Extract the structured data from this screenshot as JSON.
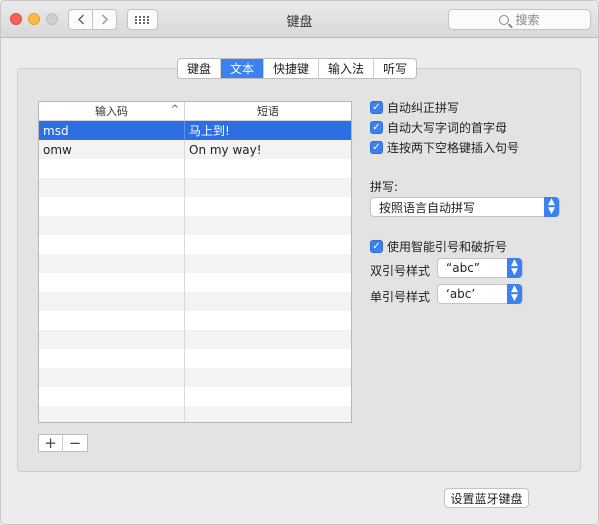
{
  "window": {
    "title": "键盘",
    "search_placeholder": "搜索"
  },
  "tabs": [
    {
      "label": "键盘",
      "active": false
    },
    {
      "label": "文本",
      "active": true
    },
    {
      "label": "快捷键",
      "active": false
    },
    {
      "label": "输入法",
      "active": false
    },
    {
      "label": "听写",
      "active": false
    }
  ],
  "table": {
    "columns": [
      "输入码",
      "短语"
    ],
    "sort_indicator": "^",
    "rows": [
      {
        "code": "msd",
        "phrase": "马上到!",
        "selected": true
      },
      {
        "code": "omw",
        "phrase": "On my way!",
        "selected": false
      }
    ],
    "empty_rows": 14
  },
  "table_controls": {
    "add": "+",
    "remove": "−"
  },
  "options": {
    "autocorrect": {
      "label": "自动纠正拼写",
      "checked": true
    },
    "autocapitalize": {
      "label": "自动大写字词的首字母",
      "checked": true
    },
    "double_space_period": {
      "label": "连按两下空格键插入句号",
      "checked": true
    },
    "spelling_label": "拼写:",
    "spelling_value": "按照语言自动拼写",
    "smart_quotes": {
      "label": "使用智能引号和破折号",
      "checked": true
    },
    "double_quote_label": "双引号样式",
    "double_quote_value": "“abc”",
    "single_quote_label": "单引号样式",
    "single_quote_value": "‘abc’"
  },
  "bluetooth_button": "设置蓝牙键盘"
}
